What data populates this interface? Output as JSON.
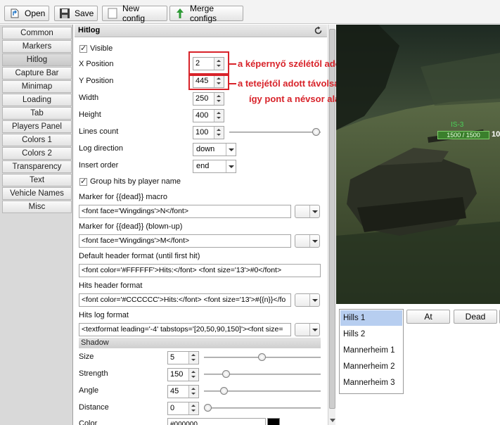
{
  "toolbar": {
    "open_label": "Open",
    "save_label": "Save",
    "new_label": "New config",
    "merge_label": "Merge configs"
  },
  "sidebar": {
    "items": [
      {
        "label": "Common"
      },
      {
        "label": "Markers"
      },
      {
        "label": "Hitlog"
      },
      {
        "label": "Capture Bar"
      },
      {
        "label": "Minimap"
      },
      {
        "label": "Loading"
      },
      {
        "label": "Tab"
      },
      {
        "label": "Players Panel"
      },
      {
        "label": "Colors 1"
      },
      {
        "label": "Colors 2"
      },
      {
        "label": "Transparency"
      },
      {
        "label": "Text"
      },
      {
        "label": "Vehicle Names"
      },
      {
        "label": "Misc"
      }
    ],
    "active_index": 2
  },
  "panel": {
    "title": "Hitlog",
    "visible_label": "Visible",
    "visible_checked": true,
    "x_position_label": "X Position",
    "x_position_value": "2",
    "y_position_label": "Y Position",
    "y_position_value": "445",
    "width_label": "Width",
    "width_value": "250",
    "height_label": "Height",
    "height_value": "400",
    "lines_count_label": "Lines count",
    "lines_count_value": "100",
    "lines_count_slider_fraction": 1.0,
    "log_direction_label": "Log direction",
    "log_direction_value": "down",
    "insert_order_label": "Insert order",
    "insert_order_value": "end",
    "group_hits_label": "Group hits by player name",
    "group_hits_checked": true,
    "marker_dead_label": "Marker for {{dead}} macro",
    "marker_dead_value": "<font face='Wingdings'>N</font>",
    "marker_blownup_label": "Marker for {{dead}} (blown-up)",
    "marker_blownup_value": "<font face='Wingdings'>M</font>",
    "default_header_label": "Default header format (until first hit)",
    "default_header_value": "<font color='#FFFFFF'>Hits:</font> <font size='13'>#0</font>",
    "hits_header_label": "Hits header format",
    "hits_header_value": "<font color='#CCCCCC'>Hits:</font> <font size='13'>#{{n}}</fo",
    "hits_log_label": "Hits log format",
    "hits_log_value": "<textformat leading='-4' tabstops='[20,50,90,150]'><font size=",
    "shadow_section": "Shadow",
    "size_label": "Size",
    "size_value": "5",
    "size_slider_fraction": 0.5,
    "strength_label": "Strength",
    "strength_value": "150",
    "strength_slider_fraction": 0.17,
    "angle_label": "Angle",
    "angle_value": "45",
    "angle_slider_fraction": 0.15,
    "distance_label": "Distance",
    "distance_value": "0",
    "distance_slider_fraction": 0.0,
    "color_label": "Color",
    "color_value": "#000000"
  },
  "annotations": {
    "x_note": "a képernyő szélétől adott távolság",
    "y_note_line1": "a tetejétől adott távolság, nekem",
    "y_note_line2": "így pont a névsor alá tette"
  },
  "preview": {
    "vehicle_name": "IS-3",
    "hp_text": "1500 / 1500",
    "hp_extra": "10"
  },
  "preview_controls": {
    "list": [
      "Hills 1",
      "Hills 2",
      "Mannerheim 1",
      "Mannerheim 2",
      "Mannerheim 3"
    ],
    "selected_index": 0,
    "at_label": "At",
    "dead_label": "Dead"
  },
  "colors": {
    "annotation_red": "#d8232a",
    "hp_green": "#3a7f2c",
    "list_selected": "#b7cef0"
  }
}
